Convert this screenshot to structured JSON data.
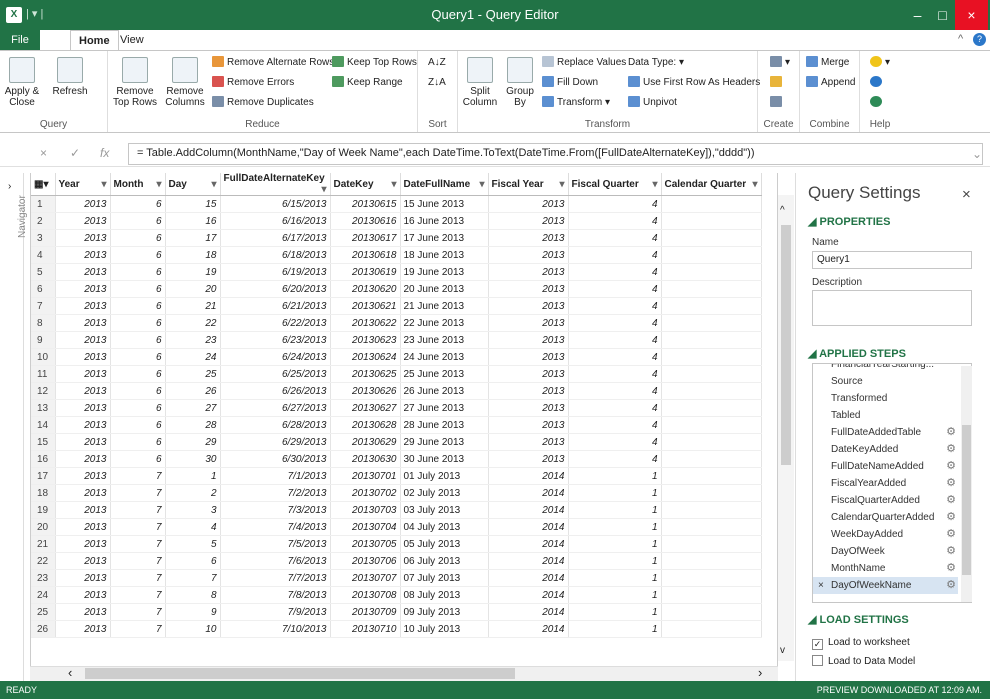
{
  "app": {
    "title": "Query1 - Query Editor",
    "qat": "| ▾ |"
  },
  "window": {
    "minimize": "–",
    "maximize": "□",
    "close": "×"
  },
  "tabs": {
    "file": "File",
    "home": "Home",
    "view": "View"
  },
  "ribbon": {
    "query": {
      "label": "Query",
      "apply": "Apply & Close",
      "refresh": "Refresh"
    },
    "reduce": {
      "label": "Reduce",
      "remove_top": "Remove Top Rows",
      "remove_cols": "Remove Columns",
      "alt_rows": "Remove Alternate Rows",
      "errors": "Remove Errors",
      "duplicates": "Remove Duplicates",
      "keep_top": "Keep Top Rows",
      "keep_range": "Keep Range"
    },
    "sort": {
      "label": "Sort"
    },
    "transform": {
      "label": "Transform",
      "split": "Split Column",
      "group": "Group By",
      "replace": "Replace Values",
      "fill": "Fill Down",
      "transform": "Transform",
      "datatype": "Data Type:",
      "first_row": "Use First Row As Headers",
      "unpivot": "Unpivot"
    },
    "create": {
      "label": "Create"
    },
    "combine": {
      "label": "Combine",
      "merge": "Merge",
      "append": "Append"
    },
    "help": {
      "label": "Help"
    }
  },
  "formula": {
    "cancel": "×",
    "accept": "✓",
    "fx": "fx",
    "text": "= Table.AddColumn(MonthName,\"Day of Week Name\",each DateTime.ToText(DateTime.From([FullDateAlternateKey]),\"dddd\"))",
    "expand": "⌄"
  },
  "navigator": "Navigator",
  "grid": {
    "columns": [
      "Year",
      "Month",
      "Day",
      "FullDateAlternateKey",
      "DateKey",
      "DateFullName",
      "Fiscal Year",
      "Fiscal Quarter",
      "Calendar Quarter"
    ],
    "rows": [
      [
        "1",
        "2013",
        "6",
        "15",
        "6/15/2013",
        "20130615",
        "15 June 2013",
        "2013",
        "4"
      ],
      [
        "2",
        "2013",
        "6",
        "16",
        "6/16/2013",
        "20130616",
        "16 June 2013",
        "2013",
        "4"
      ],
      [
        "3",
        "2013",
        "6",
        "17",
        "6/17/2013",
        "20130617",
        "17 June 2013",
        "2013",
        "4"
      ],
      [
        "4",
        "2013",
        "6",
        "18",
        "6/18/2013",
        "20130618",
        "18 June 2013",
        "2013",
        "4"
      ],
      [
        "5",
        "2013",
        "6",
        "19",
        "6/19/2013",
        "20130619",
        "19 June 2013",
        "2013",
        "4"
      ],
      [
        "6",
        "2013",
        "6",
        "20",
        "6/20/2013",
        "20130620",
        "20 June 2013",
        "2013",
        "4"
      ],
      [
        "7",
        "2013",
        "6",
        "21",
        "6/21/2013",
        "20130621",
        "21 June 2013",
        "2013",
        "4"
      ],
      [
        "8",
        "2013",
        "6",
        "22",
        "6/22/2013",
        "20130622",
        "22 June 2013",
        "2013",
        "4"
      ],
      [
        "9",
        "2013",
        "6",
        "23",
        "6/23/2013",
        "20130623",
        "23 June 2013",
        "2013",
        "4"
      ],
      [
        "10",
        "2013",
        "6",
        "24",
        "6/24/2013",
        "20130624",
        "24 June 2013",
        "2013",
        "4"
      ],
      [
        "11",
        "2013",
        "6",
        "25",
        "6/25/2013",
        "20130625",
        "25 June 2013",
        "2013",
        "4"
      ],
      [
        "12",
        "2013",
        "6",
        "26",
        "6/26/2013",
        "20130626",
        "26 June 2013",
        "2013",
        "4"
      ],
      [
        "13",
        "2013",
        "6",
        "27",
        "6/27/2013",
        "20130627",
        "27 June 2013",
        "2013",
        "4"
      ],
      [
        "14",
        "2013",
        "6",
        "28",
        "6/28/2013",
        "20130628",
        "28 June 2013",
        "2013",
        "4"
      ],
      [
        "15",
        "2013",
        "6",
        "29",
        "6/29/2013",
        "20130629",
        "29 June 2013",
        "2013",
        "4"
      ],
      [
        "16",
        "2013",
        "6",
        "30",
        "6/30/2013",
        "20130630",
        "30 June 2013",
        "2013",
        "4"
      ],
      [
        "17",
        "2013",
        "7",
        "1",
        "7/1/2013",
        "20130701",
        "01 July 2013",
        "2014",
        "1"
      ],
      [
        "18",
        "2013",
        "7",
        "2",
        "7/2/2013",
        "20130702",
        "02 July 2013",
        "2014",
        "1"
      ],
      [
        "19",
        "2013",
        "7",
        "3",
        "7/3/2013",
        "20130703",
        "03 July 2013",
        "2014",
        "1"
      ],
      [
        "20",
        "2013",
        "7",
        "4",
        "7/4/2013",
        "20130704",
        "04 July 2013",
        "2014",
        "1"
      ],
      [
        "21",
        "2013",
        "7",
        "5",
        "7/5/2013",
        "20130705",
        "05 July 2013",
        "2014",
        "1"
      ],
      [
        "22",
        "2013",
        "7",
        "6",
        "7/6/2013",
        "20130706",
        "06 July 2013",
        "2014",
        "1"
      ],
      [
        "23",
        "2013",
        "7",
        "7",
        "7/7/2013",
        "20130707",
        "07 July 2013",
        "2014",
        "1"
      ],
      [
        "24",
        "2013",
        "7",
        "8",
        "7/8/2013",
        "20130708",
        "08 July 2013",
        "2014",
        "1"
      ],
      [
        "25",
        "2013",
        "7",
        "9",
        "7/9/2013",
        "20130709",
        "09 July 2013",
        "2014",
        "1"
      ],
      [
        "26",
        "2013",
        "7",
        "10",
        "7/10/2013",
        "20130710",
        "10 July 2013",
        "2014",
        "1"
      ]
    ]
  },
  "settings": {
    "title": "Query Settings",
    "close": "×",
    "properties": "◢ PROPERTIES",
    "name_label": "Name",
    "name_value": "Query1",
    "desc_label": "Description",
    "applied_steps": "◢ APPLIED STEPS",
    "steps": [
      "FinancialYearStarting...",
      "Source",
      "Transformed",
      "Tabled",
      "FullDateAddedTable",
      "DateKeyAdded",
      "FullDateNameAdded",
      "FiscalYearAdded",
      "FiscalQuarterAdded",
      "CalendarQuarterAdded",
      "WeekDayAdded",
      "DayOfWeek",
      "MonthName",
      "DayOfWeekName"
    ],
    "load_settings": "◢ LOAD SETTINGS",
    "load_ws": "Load to worksheet",
    "load_dm": "Load to Data Model"
  },
  "status": {
    "left": "READY",
    "right": "PREVIEW DOWNLOADED AT 12:09 AM."
  },
  "colors": {
    "accent": "#217346"
  }
}
